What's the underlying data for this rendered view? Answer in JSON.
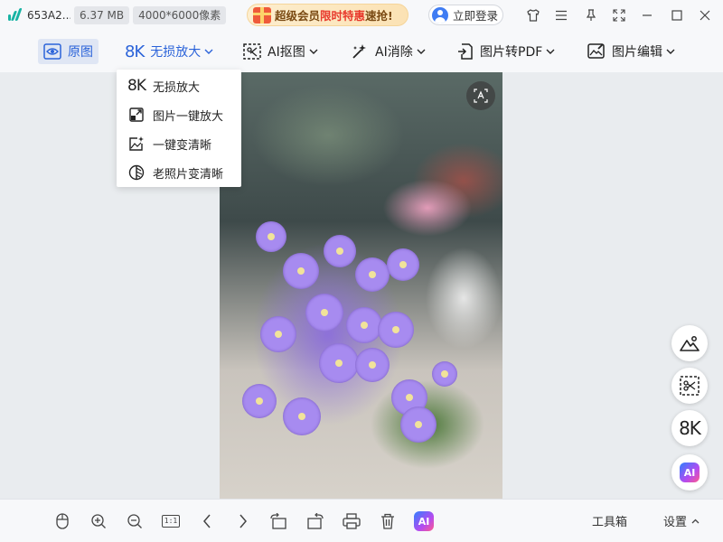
{
  "titlebar": {
    "file_name": "653A2...",
    "file_size": "6.37 MB",
    "dimensions": "4000*6000像素",
    "promo_prefix": "超级会员",
    "promo_highlight": "限时特惠",
    "promo_suffix": "速抢!",
    "login_label": "立即登录"
  },
  "toolbar": {
    "original_label": "原图",
    "lossless_icon_text": "8K",
    "lossless_label": "无损放大",
    "cutout_label": "AI抠图",
    "erase_label": "AI消除",
    "to_pdf_label": "图片转PDF",
    "edit_label": "图片编辑"
  },
  "dropdown": {
    "items": [
      {
        "icon_text": "8K",
        "label": "无损放大"
      },
      {
        "label": "图片一键放大"
      },
      {
        "label": "一键变清晰"
      },
      {
        "label": "老照片变清晰"
      }
    ]
  },
  "floating": {
    "upscale_text": "8K",
    "ai_text": "AI"
  },
  "bottombar": {
    "ai_text": "AI",
    "toolbox_label": "工具箱",
    "settings_label": "设置",
    "ratio_label": "1:1"
  },
  "colors": {
    "accent": "#2b63d9",
    "logo": "#17b3a3",
    "promo_red": "#e8392c"
  }
}
